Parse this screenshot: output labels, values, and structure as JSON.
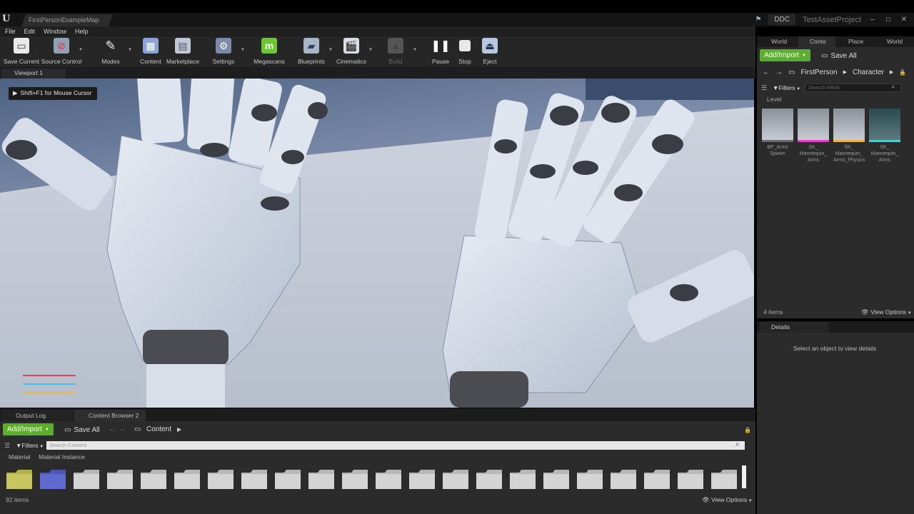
{
  "titlebar": {
    "map_tab": "FirstPersonExampleMap",
    "ddc": "DDC",
    "project": "TestAssetProject"
  },
  "menu": [
    "File",
    "Edit",
    "Window",
    "Help"
  ],
  "toolbar": {
    "save_current": "Save Current",
    "source_control": "Source Control",
    "modes": "Modes",
    "content": "Content",
    "marketplace": "Marketplace",
    "settings": "Settings",
    "megascans": "Megascans",
    "blueprints": "Blueprints",
    "cinematics": "Cinematics",
    "build": "Build",
    "pause": "Pause",
    "stop": "Stop",
    "eject": "Eject"
  },
  "viewport": {
    "tab": "Viewport 1",
    "hint": "Shift+F1 for Mouse Cursor"
  },
  "bottom": {
    "tab_log": "Output Log",
    "tab_cb": "Content Browser 2",
    "add_import": "Add/Import",
    "save_all": "Save All",
    "path_root": "Content",
    "filters": "Filters",
    "search_placeholder": "Search Content",
    "chips": [
      "Material",
      "Material Instance"
    ],
    "item_count": "92 items",
    "view_options": "View Options"
  },
  "right": {
    "tabs": [
      "World",
      "Conte",
      "Place",
      "World"
    ],
    "add_import": "Add/Import",
    "save_all": "Save All",
    "path": [
      "FirstPerson",
      "Character"
    ],
    "filters": "Filters",
    "search_placeholder": "Search Mesh",
    "level_label": "Level",
    "assets": [
      {
        "name": "BP_Arms Spawn",
        "bar": "#6a6a6a"
      },
      {
        "name": "SK_ Mannequin_ Arms",
        "bar": "#e040c8"
      },
      {
        "name": "SK_ Mannequin_ Arms_Physics",
        "bar": "#e8b050"
      },
      {
        "name": "SK_ Mannequin_ Arms",
        "bar": "#50c8d0"
      }
    ],
    "item_count": "4 items",
    "view_options": "View Options",
    "details_tab": "Details",
    "details_msg": "Select an object to view details"
  },
  "colors": {
    "accent_green": "#5cae2c",
    "megascans_green": "#6cc832"
  }
}
